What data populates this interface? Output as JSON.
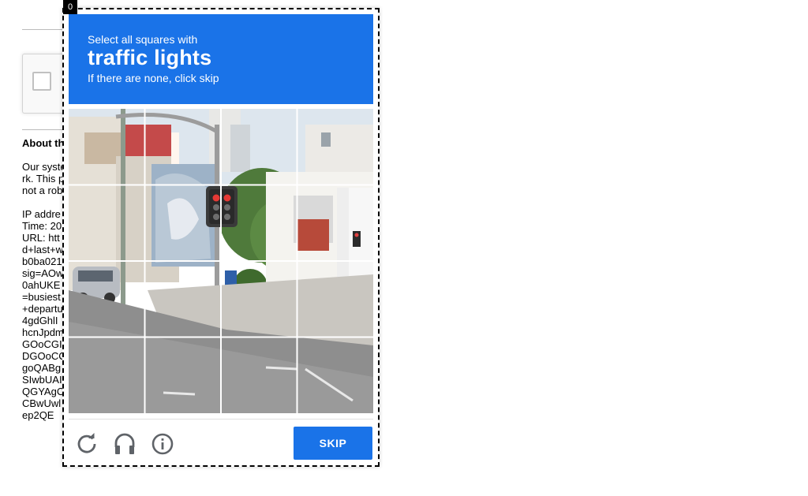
{
  "frame": {
    "index_label": "0"
  },
  "challenge": {
    "instruction_line1": "Select all squares with",
    "target_object": "traffic lights",
    "instruction_line3": "If there are none, click skip",
    "grid_size": 4,
    "tiles": [
      "r1c1",
      "r1c2",
      "r1c3",
      "r1c4",
      "r2c1",
      "r2c2",
      "r2c3",
      "r2c4",
      "r3c1",
      "r3c2",
      "r3c3",
      "r3c4",
      "r4c1",
      "r4c2",
      "r4c3",
      "r4c4"
    ]
  },
  "footer": {
    "reload_icon": "reload-icon",
    "audio_icon": "headphones-icon",
    "info_icon": "info-icon",
    "skip_label": "SKIP"
  },
  "background_page": {
    "about_heading": "About th",
    "text_lines": [
      "Our syste",
      "rk. This p",
      "not a rob",
      "",
      "IP addre",
      "Time: 20",
      "URL: htt",
      "d+last+w",
      "b0ba021",
      "sig=AOw",
      "0ahUKE",
      "=busiest",
      "+departu",
      "4gdGhlI",
      "hcnJpdm",
      "GOoCGI",
      "DGOoCC",
      "goQABg",
      "SIwbUAI",
      "QGYAgC",
      "CBwUwl",
      "ep2QE"
    ]
  },
  "colors": {
    "header_blue": "#1a73e8",
    "skip_blue": "#1a73e8"
  }
}
